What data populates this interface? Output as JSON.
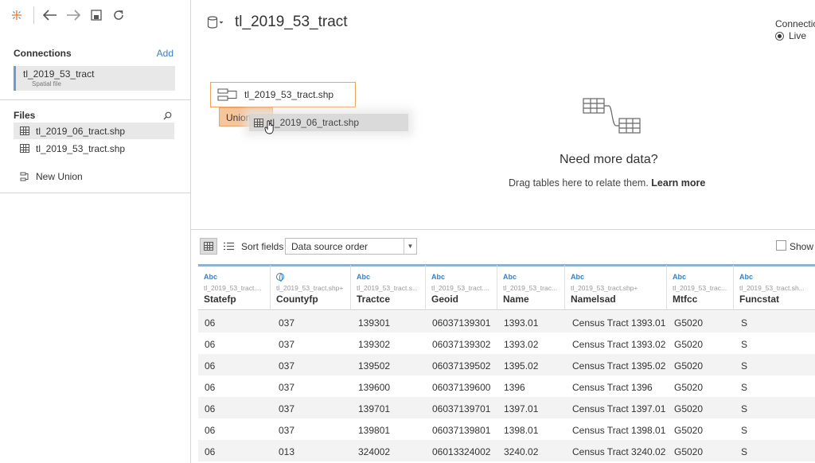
{
  "sidebar": {
    "connections_title": "Connections",
    "add_label": "Add",
    "connection": {
      "name": "tl_2019_53_tract",
      "type": "Spatial file"
    },
    "files_title": "Files",
    "files": [
      {
        "name": "tl_2019_06_tract.shp",
        "selected": true
      },
      {
        "name": "tl_2019_53_tract.shp",
        "selected": false
      }
    ],
    "new_union": "New Union"
  },
  "canvas": {
    "datasource_name": "tl_2019_53_tract",
    "connection_label": "Connection",
    "live_label": "Live",
    "table_card": "tl_2019_53_tract.shp",
    "union_label": "Union",
    "drag_chip": "tl_2019_06_tract.shp",
    "need_more_title": "Need more data?",
    "drag_hint": "Drag tables here to relate them.",
    "learn_more": "Learn more"
  },
  "grid_bar": {
    "sort_label": "Sort fields",
    "sort_value": "Data source order",
    "show_label": "Show a"
  },
  "columns": [
    {
      "type": "Abc",
      "source": "tl_2019_53_tract....",
      "name": "Statefp"
    },
    {
      "type": "",
      "source": "tl_2019_53_tract.shp+",
      "name": "Countyfp"
    },
    {
      "type": "Abc",
      "source": "tl_2019_53_tract.s...",
      "name": "Tractce"
    },
    {
      "type": "Abc",
      "source": "tl_2019_53_tract....",
      "name": "Geoid"
    },
    {
      "type": "Abc",
      "source": "tl_2019_53_trac...",
      "name": "Name"
    },
    {
      "type": "Abc",
      "source": "tl_2019_53_tract.shp+",
      "name": "Namelsad"
    },
    {
      "type": "Abc",
      "source": "tl_2019_53_trac...",
      "name": "Mtfcc"
    },
    {
      "type": "Abc",
      "source": "tl_2019_53_tract.sh...",
      "name": "Funcstat"
    }
  ],
  "rows": [
    [
      "06",
      "037",
      "139301",
      "06037139301",
      "1393.01",
      "Census Tract 1393.01",
      "G5020",
      "S"
    ],
    [
      "06",
      "037",
      "139302",
      "06037139302",
      "1393.02",
      "Census Tract 1393.02",
      "G5020",
      "S"
    ],
    [
      "06",
      "037",
      "139502",
      "06037139502",
      "1395.02",
      "Census Tract 1395.02",
      "G5020",
      "S"
    ],
    [
      "06",
      "037",
      "139600",
      "06037139600",
      "1396",
      "Census Tract 1396",
      "G5020",
      "S"
    ],
    [
      "06",
      "037",
      "139701",
      "06037139701",
      "1397.01",
      "Census Tract 1397.01",
      "G5020",
      "S"
    ],
    [
      "06",
      "037",
      "139801",
      "06037139801",
      "1398.01",
      "Census Tract 1398.01",
      "G5020",
      "S"
    ],
    [
      "06",
      "013",
      "324002",
      "06013324002",
      "3240.02",
      "Census Tract 3240.02",
      "G5020",
      "S"
    ]
  ],
  "colors": {
    "accent": "#3a7fc1",
    "union_orange": "#f0a35a",
    "union_fill": "#f5c59b"
  }
}
